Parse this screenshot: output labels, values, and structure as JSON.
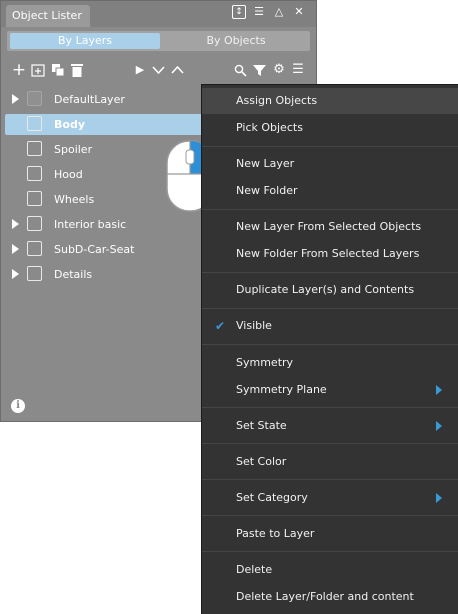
{
  "window": {
    "title": "Object Lister"
  },
  "tabs": [
    {
      "label": "By Layers",
      "active": true
    },
    {
      "label": "By Objects",
      "active": false
    }
  ],
  "toolbar": {
    "icons": [
      "add-icon",
      "new-folder-icon",
      "duplicate-icon",
      "delete-icon",
      "play-icon",
      "chevron-down-icon",
      "chevron-up-icon",
      "search-icon",
      "filter-icon",
      "gear-icon",
      "menu-icon"
    ]
  },
  "tree": [
    {
      "label": "DefaultLayer",
      "expandable": true,
      "selected": false
    },
    {
      "label": "Body",
      "expandable": false,
      "selected": true
    },
    {
      "label": "Spoiler",
      "expandable": false,
      "selected": false
    },
    {
      "label": "Hood",
      "expandable": false,
      "selected": false
    },
    {
      "label": "Wheels",
      "expandable": false,
      "selected": false
    },
    {
      "label": "Interior basic",
      "expandable": true,
      "selected": false
    },
    {
      "label": "SubD-Car-Seat",
      "expandable": true,
      "selected": false
    },
    {
      "label": "Details",
      "expandable": true,
      "selected": false
    }
  ],
  "menu": {
    "items": [
      {
        "label": "Assign Objects",
        "highlighted": true
      },
      {
        "label": "Pick Objects"
      },
      {
        "label": "New Layer"
      },
      {
        "label": "New Folder"
      },
      {
        "label": "New Layer From Selected Objects"
      },
      {
        "label": "New Folder From Selected Layers"
      },
      {
        "label": "Duplicate Layer(s) and Contents"
      },
      {
        "label": "Visible",
        "checked": true
      },
      {
        "label": "Symmetry"
      },
      {
        "label": "Symmetry Plane",
        "submenu": true
      },
      {
        "label": "Set State",
        "submenu": true
      },
      {
        "label": "Set Color"
      },
      {
        "label": "Set Category",
        "submenu": true
      },
      {
        "label": "Paste to Layer"
      },
      {
        "label": "Delete"
      },
      {
        "label": "Delete Layer/Folder and content"
      }
    ]
  },
  "colors": {
    "panel_bg": "#8a8a8a",
    "selection": "#a9cfe9",
    "menu_bg": "#333333",
    "accent": "#3a9ad9"
  }
}
